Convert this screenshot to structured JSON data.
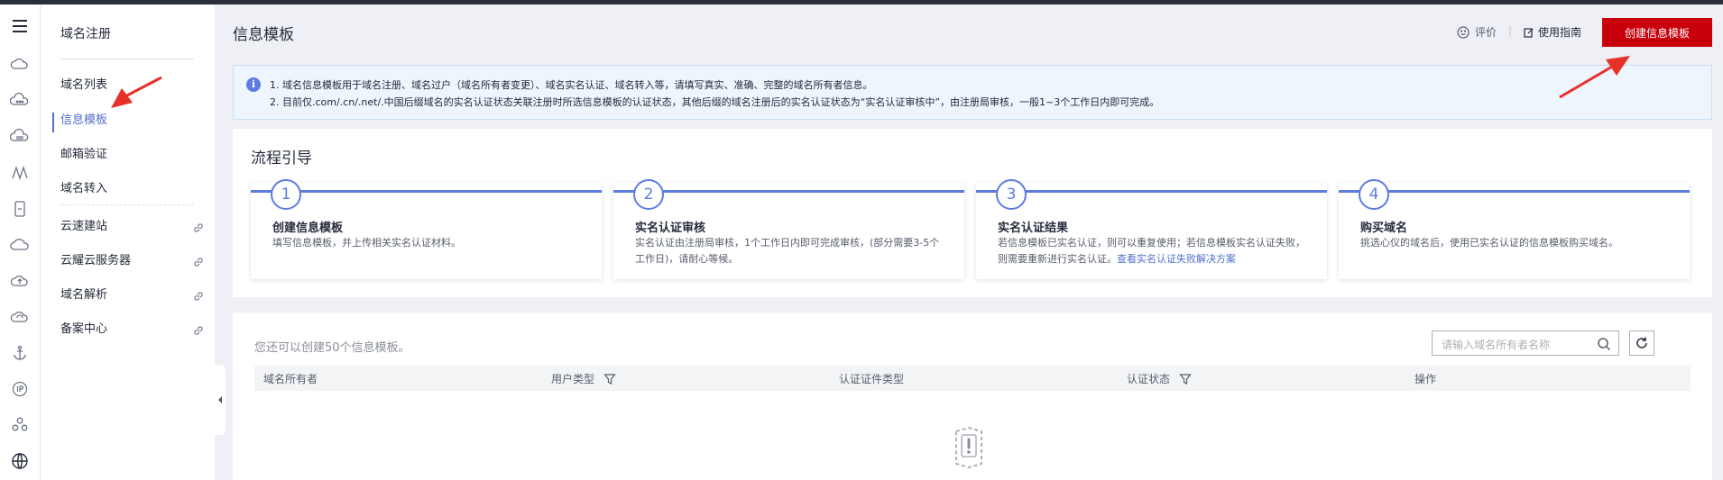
{
  "nav": {
    "title": "域名注册",
    "items": [
      {
        "label": "域名列表"
      },
      {
        "label": "信息模板"
      },
      {
        "label": "邮箱验证"
      },
      {
        "label": "域名转入"
      },
      {
        "label": "云速建站"
      },
      {
        "label": "云耀云服务器"
      },
      {
        "label": "域名解析"
      },
      {
        "label": "备案中心"
      }
    ]
  },
  "header": {
    "title": "信息模板",
    "rate_label": "评价",
    "guide_label": "使用指南",
    "create_button": "创建信息模板"
  },
  "banner": {
    "line1": "1. 域名信息模板用于域名注册、域名过户（域名所有者变更）、域名实名认证、域名转入等，请填写真实、准确、完整的域名所有者信息。",
    "line2": "2. 目前仅.com/.cn/.net/.中国后缀域名的实名认证状态关联注册时所选信息模板的认证状态，其他后缀的域名注册后的实名认证状态为“实名认证审核中”，由注册局审核，一般1~3个工作日内即可完成。"
  },
  "flow": {
    "title": "流程引导",
    "steps": [
      {
        "num": "1",
        "title": "创建信息模板",
        "desc": "填写信息模板，并上传相关实名认证材料。"
      },
      {
        "num": "2",
        "title": "实名认证审核",
        "desc": "实名认证由注册局审核，1个工作日内即可完成审核，(部分需要3-5个工作日)，请耐心等候。"
      },
      {
        "num": "3",
        "title": "实名认证结果",
        "desc": "若信息模板已实名认证，则可以重复使用；若信息模板实名认证失败，则需要重新进行实名认证。",
        "link": "查看实名认证失败解决方案"
      },
      {
        "num": "4",
        "title": "购买域名",
        "desc": "挑选心仪的域名后，使用已实名认证的信息模板购买域名。"
      }
    ]
  },
  "table": {
    "remaining_text": "您还可以创建50个信息模板。",
    "search_placeholder": "请输入域名所有者名称",
    "columns": [
      "域名所有者",
      "用户类型",
      "认证证件类型",
      "认证状态",
      "操作"
    ]
  },
  "colors": {
    "accent": "#526ecc",
    "brand_red": "#c7000b",
    "annotation_arrow": "#e8302a"
  }
}
